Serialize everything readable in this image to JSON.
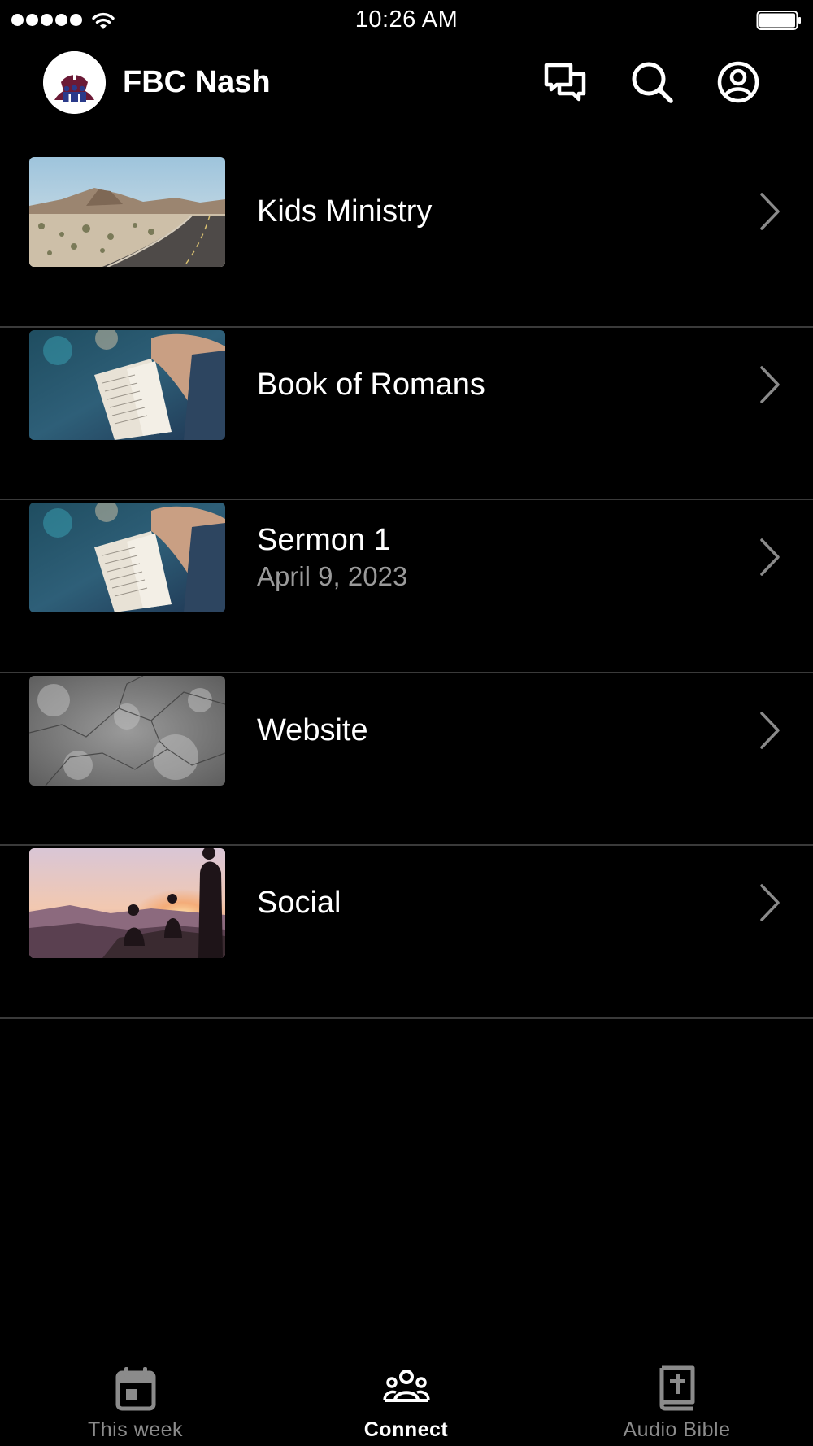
{
  "status_bar": {
    "time": "10:26 AM",
    "signal_icon": "signal-dots-icon",
    "wifi_icon": "wifi-icon",
    "battery_icon": "battery-icon",
    "battery_level": 1.0
  },
  "header": {
    "title": "FBC Nash",
    "logo_icon": "church-logo-icon",
    "actions": [
      {
        "name": "chat-icon"
      },
      {
        "name": "search-icon"
      },
      {
        "name": "profile-icon"
      }
    ]
  },
  "list": {
    "items": [
      {
        "title": "Kids Ministry",
        "subtitle": "",
        "thumbnail": "desert-road-image"
      },
      {
        "title": "Book of Romans",
        "subtitle": "",
        "thumbnail": "open-bible-image"
      },
      {
        "title": "Sermon 1",
        "subtitle": "April 9, 2023",
        "thumbnail": "open-bible-image"
      },
      {
        "title": "Website",
        "subtitle": "",
        "thumbnail": "marble-texture-image"
      },
      {
        "title": "Social",
        "subtitle": "",
        "thumbnail": "sunset-people-image"
      }
    ]
  },
  "tab_bar": {
    "tabs": [
      {
        "label": "This week",
        "icon": "calendar-icon",
        "active": false
      },
      {
        "label": "Connect",
        "icon": "people-group-icon",
        "active": true
      },
      {
        "label": "Audio Bible",
        "icon": "bible-icon",
        "active": false
      }
    ]
  },
  "colors": {
    "background": "#000000",
    "text_primary": "#ffffff",
    "text_secondary": "#9a9a9a",
    "divider": "#3a3a3a",
    "tab_inactive": "#8b8b8b",
    "logo_maroon": "#6b1a36",
    "logo_navy": "#2a3a8a"
  }
}
